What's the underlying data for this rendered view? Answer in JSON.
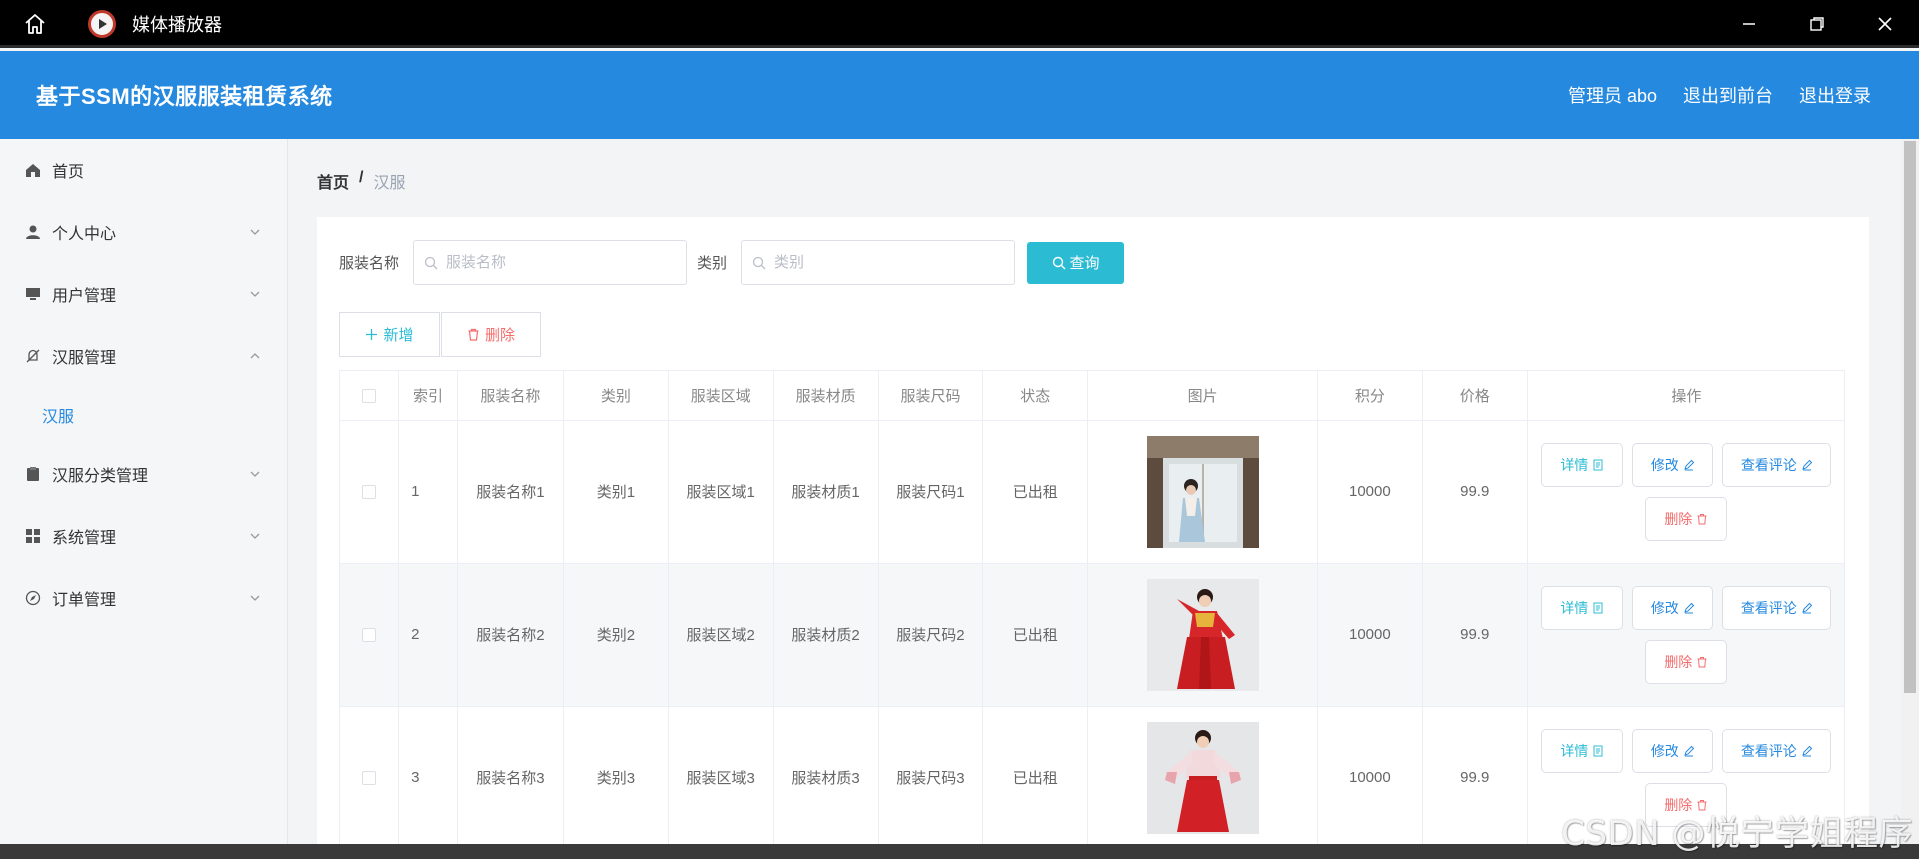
{
  "window": {
    "app_title": "媒体播放器",
    "home_icon": "home-icon",
    "app_icon": "media-player-icon",
    "controls": [
      "minimize-icon",
      "restore-icon",
      "close-icon"
    ]
  },
  "header": {
    "title": "基于SSM的汉服服装租赁系统",
    "admin_label": "管理员 abo",
    "back_to_front": "退出到前台",
    "logout": "退出登录",
    "color": "#2589e0"
  },
  "sidebar": {
    "items": [
      {
        "label": "首页",
        "icon": "home-icon"
      },
      {
        "label": "个人中心",
        "icon": "user-icon"
      },
      {
        "label": "用户管理",
        "icon": "monitor-icon"
      },
      {
        "label": "汉服管理",
        "icon": "bell-off-icon"
      },
      {
        "label": "汉服分类管理",
        "icon": "clipboard-icon"
      },
      {
        "label": "系统管理",
        "icon": "grid-icon"
      },
      {
        "label": "订单管理",
        "icon": "compass-icon"
      }
    ],
    "sub_active": "汉服"
  },
  "breadcrumb": {
    "home": "首页",
    "separator": "/",
    "current": "汉服"
  },
  "search": {
    "name_label": "服装名称",
    "name_placeholder": "服装名称",
    "category_label": "类别",
    "category_placeholder": "类别",
    "query_button": "查询"
  },
  "actions": {
    "add": "新增",
    "delete": "删除"
  },
  "table": {
    "headers": [
      "索引",
      "服装名称",
      "类别",
      "服装区域",
      "服装材质",
      "服装尺码",
      "状态",
      "图片",
      "积分",
      "价格",
      "操作"
    ],
    "rows": [
      {
        "index": "1",
        "name": "服装名称1",
        "category": "类别1",
        "region": "服装区域1",
        "material": "服装材质1",
        "size": "服装尺码1",
        "status": "已出租",
        "points": "10000",
        "price": "99.9"
      },
      {
        "index": "2",
        "name": "服装名称2",
        "category": "类别2",
        "region": "服装区域2",
        "material": "服装材质2",
        "size": "服装尺码2",
        "status": "已出租",
        "points": "10000",
        "price": "99.9"
      },
      {
        "index": "3",
        "name": "服装名称3",
        "category": "类别3",
        "region": "服装区域3",
        "material": "服装材质3",
        "size": "服装尺码3",
        "status": "已出租",
        "points": "10000",
        "price": "99.9"
      }
    ],
    "op_labels": {
      "detail": "详情",
      "edit": "修改",
      "review": "查看评论",
      "remove": "删除"
    }
  },
  "watermark": "CSDN @悦宁学姐程序"
}
